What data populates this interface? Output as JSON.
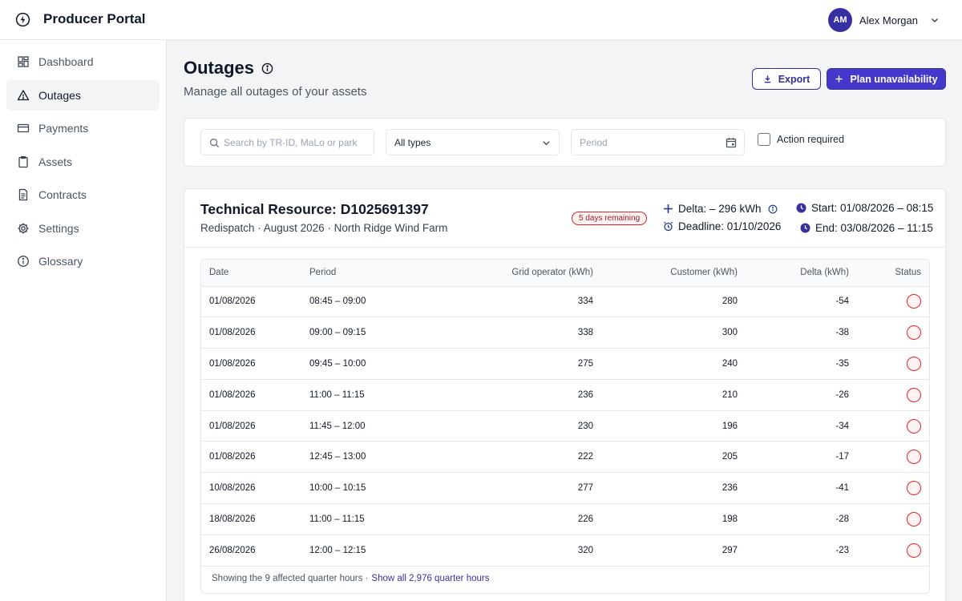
{
  "header": {
    "title": "Producer Portal",
    "user": {
      "initials": "AM",
      "name": "Alex Morgan"
    }
  },
  "sidebar": {
    "items": [
      {
        "label": "Dashboard",
        "icon": "dashboard-icon"
      },
      {
        "label": "Outages",
        "icon": "warning-icon",
        "active": true
      },
      {
        "label": "Payments",
        "icon": "credit-card-icon"
      },
      {
        "label": "Assets",
        "icon": "clipboard-icon"
      },
      {
        "label": "Contracts",
        "icon": "document-icon"
      },
      {
        "label": "Settings",
        "icon": "gear-icon"
      },
      {
        "label": "Glossary",
        "icon": "info-icon"
      }
    ]
  },
  "page": {
    "title": "Outages",
    "subtitle": "Manage all outages of your assets",
    "export_label": "Export",
    "plan_label": "Plan unavailability"
  },
  "filters": {
    "search_placeholder": "Search by TR-ID, MaLo or park",
    "type_value": "All types",
    "period_placeholder": "Period",
    "action_required_label": "Action required"
  },
  "resource": {
    "title": "Technical Resource: D1025691397",
    "subtitle": "Redispatch · August 2026 · North Ridge Wind Farm",
    "badge": "5 days remaining",
    "delta": "Delta: – 296 kWh",
    "deadline": "Deadline: 01/10/2026",
    "start": "Start: 01/08/2026 – 08:15",
    "end": "End: 03/08/2026 – 11:15"
  },
  "table": {
    "headers": {
      "date": "Date",
      "period": "Period",
      "grid": "Grid operator (kWh)",
      "customer": "Customer (kWh)",
      "delta": "Delta (kWh)",
      "status": "Status"
    },
    "rows": [
      {
        "date": "01/08/2026",
        "period": "08:45 – 09:00",
        "grid": "334",
        "customer": "280",
        "delta": "-54"
      },
      {
        "date": "01/08/2026",
        "period": "09:00 – 09:15",
        "grid": "338",
        "customer": "300",
        "delta": "-38"
      },
      {
        "date": "01/08/2026",
        "period": "09:45 – 10:00",
        "grid": "275",
        "customer": "240",
        "delta": "-35"
      },
      {
        "date": "01/08/2026",
        "period": "11:00 – 11:15",
        "grid": "236",
        "customer": "210",
        "delta": "-26"
      },
      {
        "date": "01/08/2026",
        "period": "11:45 – 12:00",
        "grid": "230",
        "customer": "196",
        "delta": "-34"
      },
      {
        "date": "01/08/2026",
        "period": "12:45 – 13:00",
        "grid": "222",
        "customer": "205",
        "delta": "-17"
      },
      {
        "date": "10/08/2026",
        "period": "10:00 – 10:15",
        "grid": "277",
        "customer": "236",
        "delta": "-41"
      },
      {
        "date": "18/08/2026",
        "period": "11:00 – 11:15",
        "grid": "226",
        "customer": "198",
        "delta": "-28"
      },
      {
        "date": "26/08/2026",
        "period": "12:00 – 12:15",
        "grid": "320",
        "customer": "297",
        "delta": "-23"
      }
    ],
    "footer_text": "Showing the 9 affected quarter hours ·",
    "footer_link": "Show all 2,976 quarter hours"
  }
}
